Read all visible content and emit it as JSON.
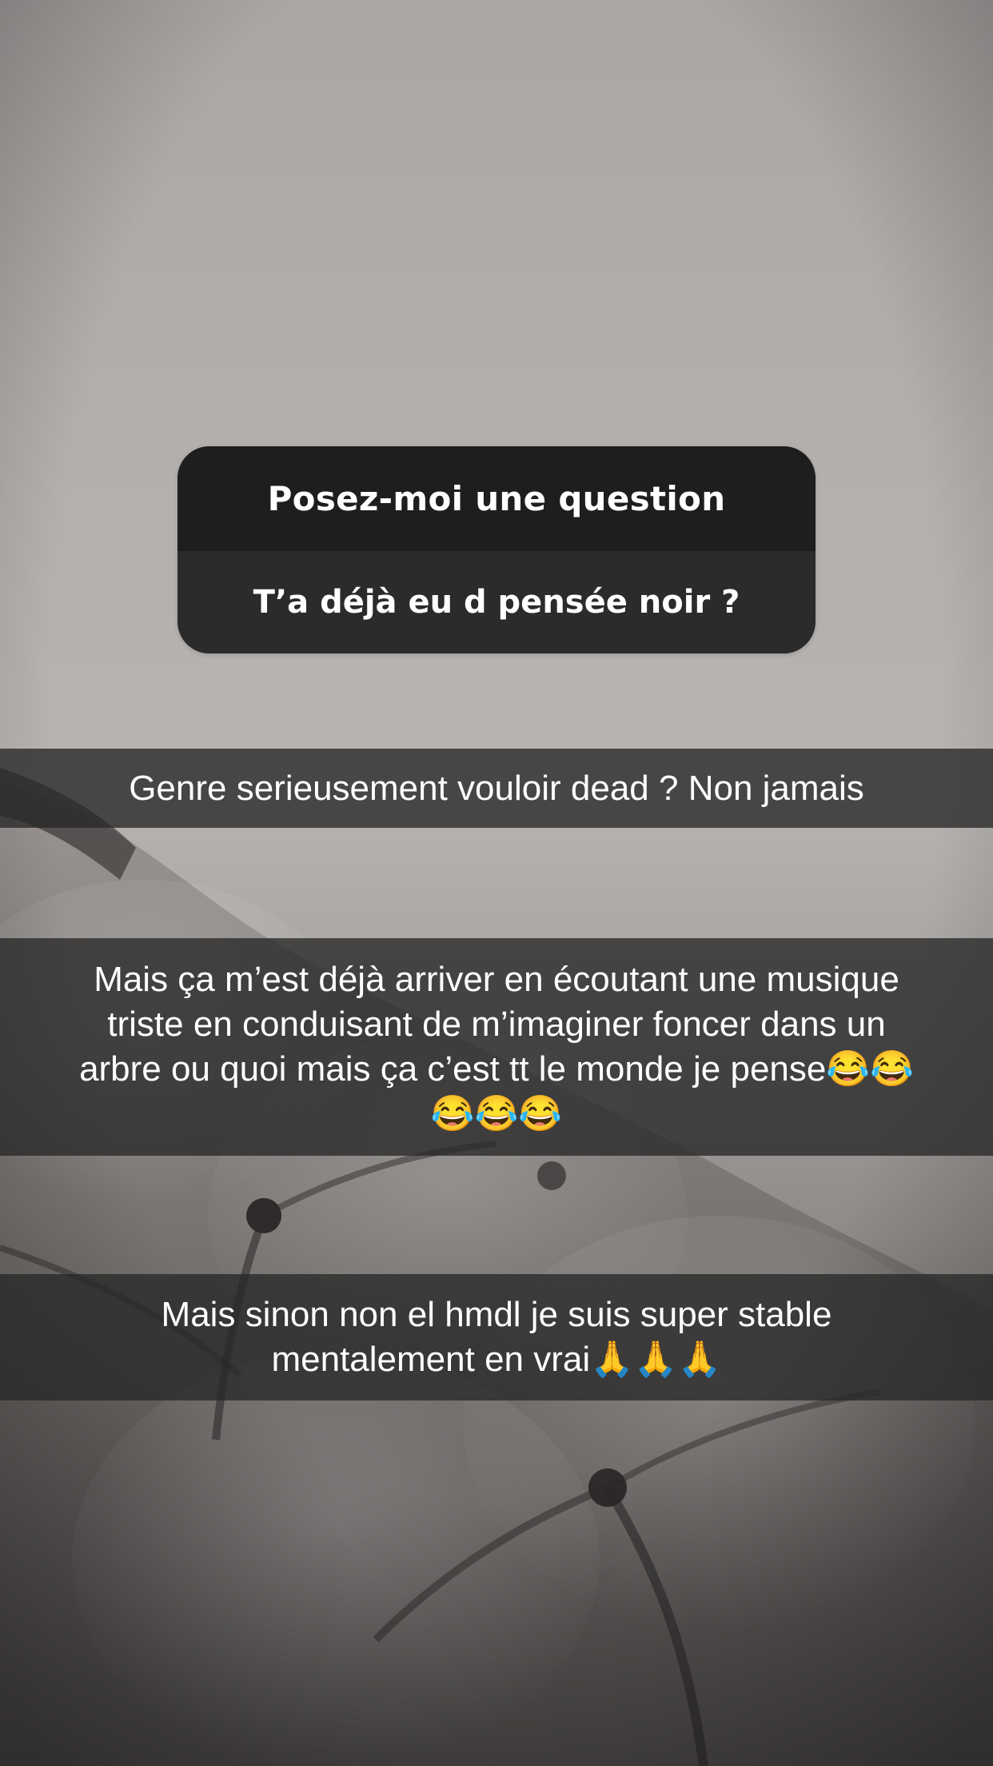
{
  "question_sticker": {
    "title": "Posez-moi une question",
    "question": "T’a déjà eu d pensée noir ?"
  },
  "captions": [
    "Genre serieusement vouloir dead ? Non jamais",
    "Mais ça m’est déjà arriver en écoutant une musique\ntriste en conduisant de m’imaginer foncer dans un\narbre ou quoi mais ça c’est tt le monde je pense😂😂\n😂😂😂",
    "Mais sinon non el hmdl je suis super stable\nmentalement en vrai🙏🙏🙏"
  ],
  "colors": {
    "sticker_header": "#1e1e1e",
    "sticker_body": "#2b2b2b",
    "caption_bar": "rgba(40,40,40,0.78)",
    "text": "#ffffff"
  }
}
